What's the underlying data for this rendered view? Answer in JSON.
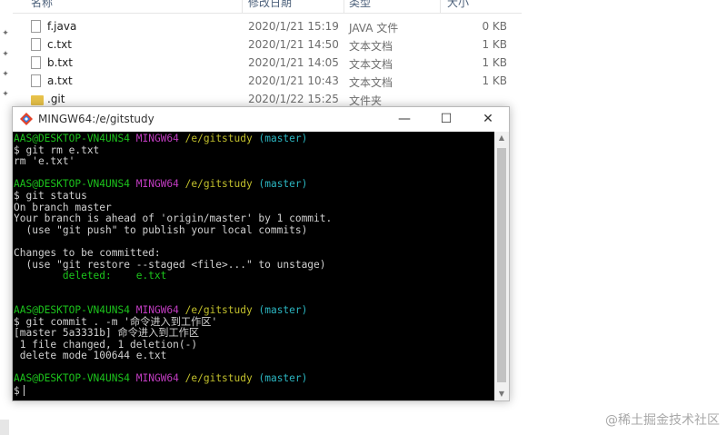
{
  "explorer": {
    "columns": {
      "name": "名称",
      "date": "修改日期",
      "type": "类型",
      "size": "大小"
    },
    "files": [
      {
        "name": "f.java",
        "date": "2020/1/21 15:19",
        "type": "JAVA 文件",
        "size": "0 KB",
        "icon": "file-icon"
      },
      {
        "name": "c.txt",
        "date": "2020/1/21 14:50",
        "type": "文本文档",
        "size": "1 KB",
        "icon": "file-icon"
      },
      {
        "name": "b.txt",
        "date": "2020/1/21 14:05",
        "type": "文本文档",
        "size": "1 KB",
        "icon": "file-icon"
      },
      {
        "name": "a.txt",
        "date": "2020/1/21 10:43",
        "type": "文本文档",
        "size": "1 KB",
        "icon": "file-icon"
      },
      {
        "name": ".git",
        "date": "2020/1/22 15:25",
        "type": "文件夹",
        "size": "",
        "icon": "folder-icon"
      }
    ]
  },
  "terminal": {
    "title": "MINGW64:/e/gitstudy",
    "prompt": {
      "user": "AAS@DESKTOP-VN4UNS4",
      "env": "MINGW64",
      "path": "/e/gitstudy",
      "branch": "(master)"
    },
    "lines": [
      {
        "kind": "prompt"
      },
      {
        "kind": "text",
        "text": "$ git rm e.txt"
      },
      {
        "kind": "text",
        "text": "rm 'e.txt'"
      },
      {
        "kind": "blank"
      },
      {
        "kind": "prompt"
      },
      {
        "kind": "text",
        "text": "$ git status"
      },
      {
        "kind": "text",
        "text": "On branch master"
      },
      {
        "kind": "text",
        "text": "Your branch is ahead of 'origin/master' by 1 commit."
      },
      {
        "kind": "text",
        "text": "  (use \"git push\" to publish your local commits)"
      },
      {
        "kind": "blank"
      },
      {
        "kind": "text",
        "text": "Changes to be committed:"
      },
      {
        "kind": "text",
        "text": "  (use \"git restore --staged <file>...\" to unstage)"
      },
      {
        "kind": "green",
        "text": "        deleted:    e.txt"
      },
      {
        "kind": "blank"
      },
      {
        "kind": "blank"
      },
      {
        "kind": "prompt"
      },
      {
        "kind": "text",
        "text": "$ git commit . -m '命令进入到工作区'"
      },
      {
        "kind": "text",
        "text": "[master 5a3331b] 命令进入到工作区"
      },
      {
        "kind": "text",
        "text": " 1 file changed, 1 deletion(-)"
      },
      {
        "kind": "text",
        "text": " delete mode 100644 e.txt"
      },
      {
        "kind": "blank"
      },
      {
        "kind": "prompt"
      },
      {
        "kind": "cursor",
        "text": "$"
      }
    ]
  },
  "watermark": "@稀土掘金技术社区"
}
